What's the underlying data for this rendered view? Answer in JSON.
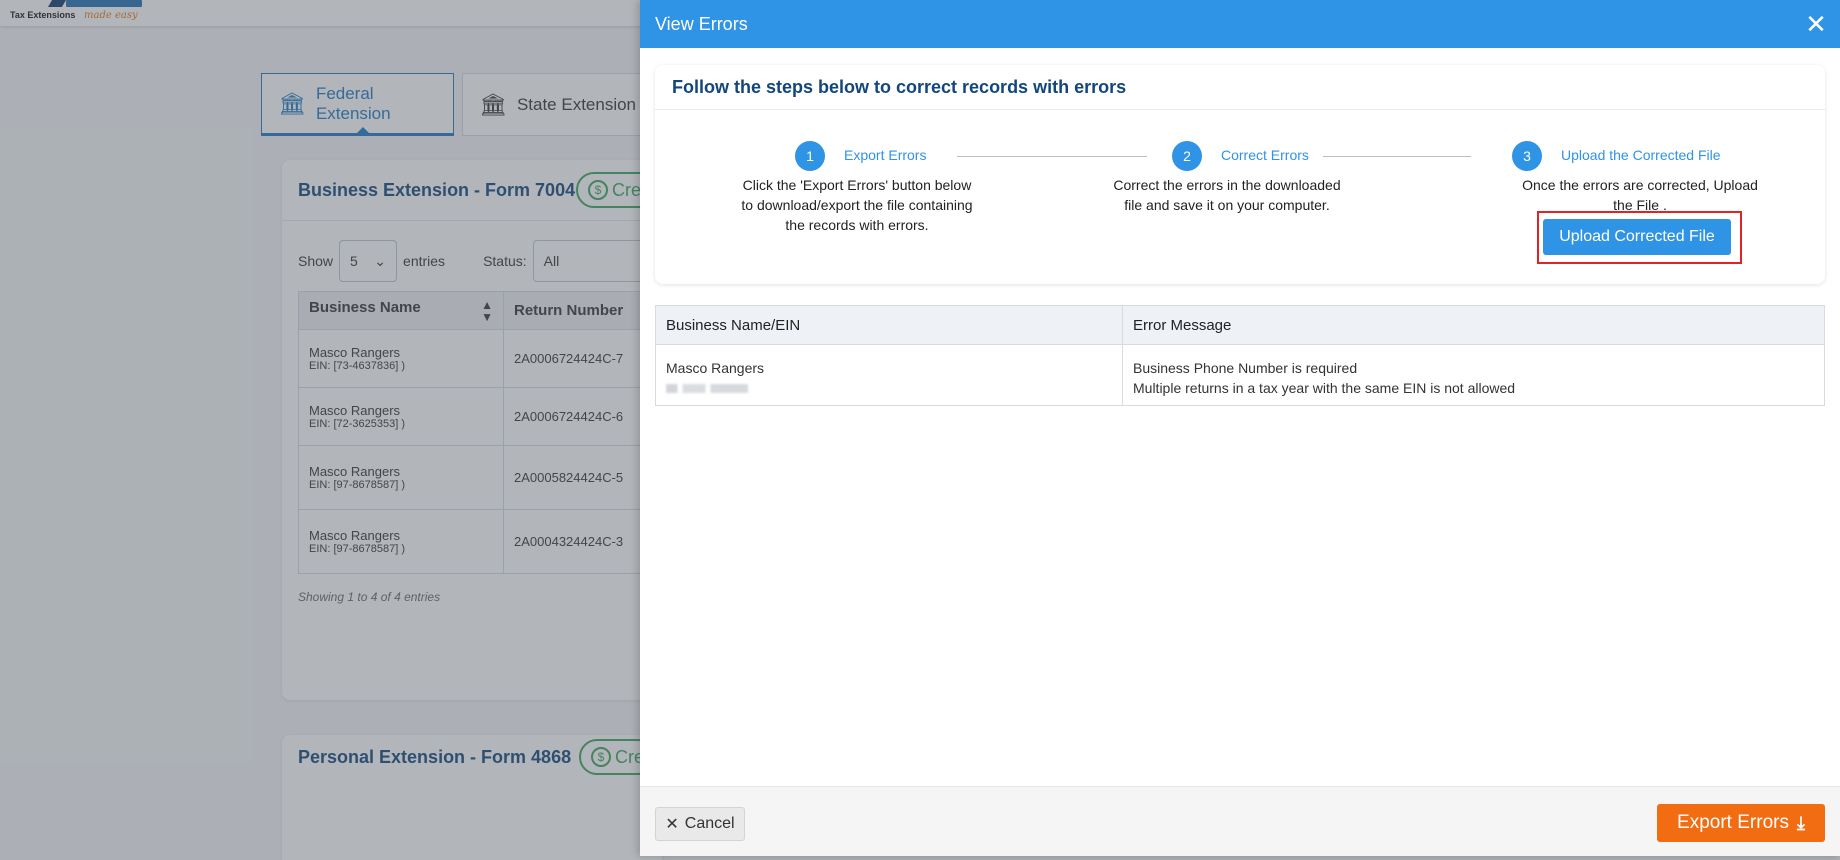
{
  "background": {
    "logo": {
      "tagline": "Tax Extensions",
      "script": "made easy",
      "brand_color": "#1f6fb5"
    },
    "tabs": [
      {
        "label": "Federal Extension",
        "icon": "bank-icon",
        "active": true
      },
      {
        "label": "State Extension",
        "icon": "capitol-icon",
        "active": false
      }
    ],
    "business_card": {
      "title": "Business Extension - Form 7004",
      "credit_label": "Cred",
      "show_label": "Show",
      "show_value": "5",
      "entries_label": "entries",
      "status_label": "Status:",
      "status_value": "All",
      "columns": [
        "Business Name",
        "Return Number"
      ],
      "rows": [
        {
          "name": "Masco Rangers",
          "ein": "EIN: [73-4637836] )",
          "return_number": "2A0006724424C-7"
        },
        {
          "name": "Masco Rangers",
          "ein": "EIN: [72-3625353] )",
          "return_number": "2A0006724424C-6"
        },
        {
          "name": "Masco Rangers",
          "ein": "EIN: [97-8678587] )",
          "return_number": "2A0005824424C-5"
        },
        {
          "name": "Masco Rangers",
          "ein": "EIN: [97-8678587] )",
          "return_number": "2A0004324424C-3"
        }
      ],
      "showing_text": "Showing 1 to 4 of 4 entries"
    },
    "personal_card": {
      "title": "Personal Extension - Form 4868",
      "credit_label": "Cre"
    }
  },
  "modal": {
    "title": "View Errors",
    "header_color": "#2f93e6",
    "heading": "Follow the steps below to correct records with errors",
    "steps": [
      {
        "number": "1",
        "title": "Export Errors",
        "desc_lines": [
          "Click the 'Export Errors' button below",
          "to download/export the file containing",
          "the records with errors."
        ]
      },
      {
        "number": "2",
        "title": "Correct Errors",
        "desc_lines": [
          "Correct the errors in the downloaded",
          "file and save it on your computer."
        ]
      },
      {
        "number": "3",
        "title": "Upload the Corrected File",
        "desc_lines": [
          "Once the errors are corrected, Upload",
          "the File ."
        ]
      }
    ],
    "upload_button": "Upload Corrected File",
    "table": {
      "columns": [
        "Business Name/EIN",
        "Error Message"
      ],
      "rows": [
        {
          "business_name": "Masco Rangers",
          "errors": [
            "Business Phone Number is required",
            "Multiple returns in a tax year with the same EIN is not allowed"
          ]
        }
      ]
    },
    "cancel_button": "Cancel",
    "export_button": "Export Errors",
    "export_color": "#f26c12",
    "highlight_color": "#e22323"
  }
}
